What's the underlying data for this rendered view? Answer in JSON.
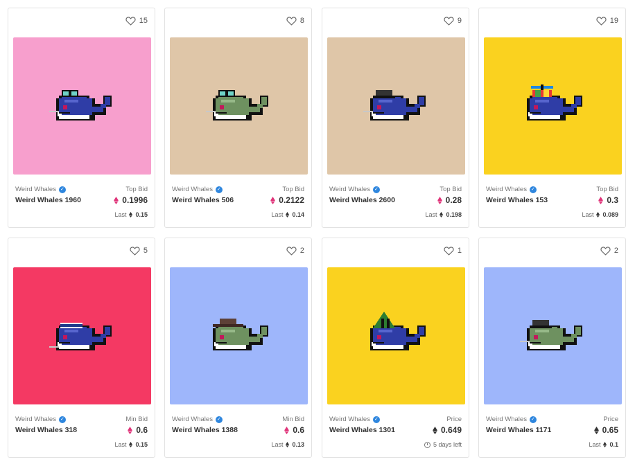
{
  "cards": [
    {
      "likes": "15",
      "bg": "#f79fcd",
      "whale": "#2f3da6",
      "hat": "goggles",
      "collection": "Weird Whales",
      "name": "Weird Whales 1960",
      "price_label": "Top Bid",
      "price": "0.1996",
      "eth_color": "#e0357a",
      "footer_label": "Last",
      "footer_value": "0.15"
    },
    {
      "likes": "8",
      "bg": "#dfc6a8",
      "whale": "#6e9160",
      "hat": "goggles",
      "collection": "Weird Whales",
      "name": "Weird Whales 506",
      "price_label": "Top Bid",
      "price": "0.2122",
      "eth_color": "#e0357a",
      "footer_label": "Last",
      "footer_value": "0.14"
    },
    {
      "likes": "9",
      "bg": "#dfc6a8",
      "whale": "#2f3da6",
      "hat": "bowler",
      "collection": "Weird Whales",
      "name": "Weird Whales 2600",
      "price_label": "Top Bid",
      "price": "0.28",
      "eth_color": "#e0357a",
      "footer_label": "Last",
      "footer_value": "0.198"
    },
    {
      "likes": "19",
      "bg": "#fad21f",
      "whale": "#2f3da6",
      "hat": "propeller",
      "collection": "Weird Whales",
      "name": "Weird Whales 153",
      "price_label": "Top Bid",
      "price": "0.3",
      "eth_color": "#e0357a",
      "footer_label": "Last",
      "footer_value": "0.089"
    },
    {
      "likes": "5",
      "bg": "#f43963",
      "whale": "#2f3da6",
      "hat": "headband",
      "collection": "Weird Whales",
      "name": "Weird Whales 318",
      "price_label": "Min Bid",
      "price": "0.6",
      "eth_color": "#e0357a",
      "footer_label": "Last",
      "footer_value": "0.15"
    },
    {
      "likes": "2",
      "bg": "#9eb6fb",
      "whale": "#6e9160",
      "hat": "cowboy",
      "collection": "Weird Whales",
      "name": "Weird Whales 1388",
      "price_label": "Min Bid",
      "price": "0.6",
      "eth_color": "#e0357a",
      "footer_label": "Last",
      "footer_value": "0.13"
    },
    {
      "likes": "1",
      "bg": "#fad21f",
      "whale": "#2f3da6",
      "hat": "wizard",
      "collection": "Weird Whales",
      "name": "Weird Whales 1301",
      "price_label": "Price",
      "price": "0.649",
      "eth_color": "#333333",
      "footer_label": "5 days left",
      "footer_value": ""
    },
    {
      "likes": "2",
      "bg": "#9eb6fb",
      "whale": "#6e9160",
      "hat": "bowler",
      "collection": "Weird Whales",
      "name": "Weird Whales 1171",
      "price_label": "Price",
      "price": "0.65",
      "eth_color": "#333333",
      "footer_label": "Last",
      "footer_value": "0.1"
    }
  ],
  "colors": {
    "border": "#e2e2e2",
    "verified": "#2e86de",
    "muted_text": "#777777"
  }
}
